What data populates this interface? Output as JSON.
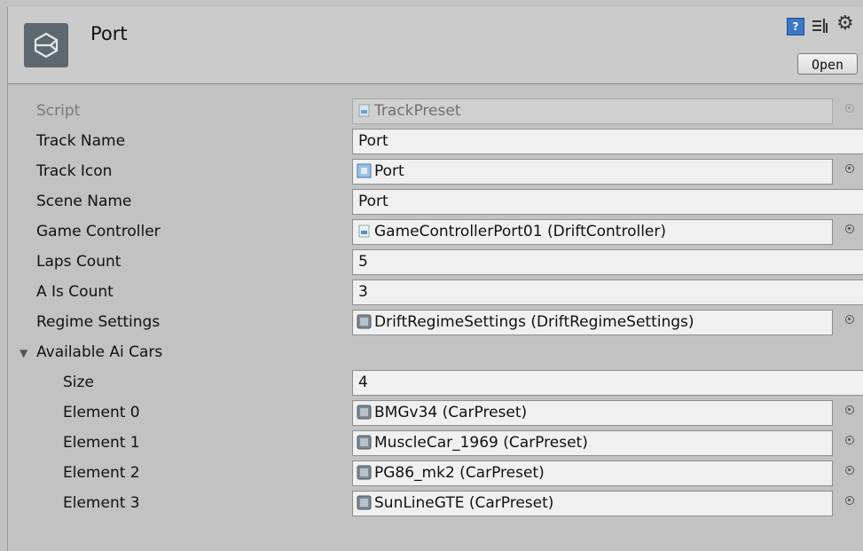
{
  "header": {
    "title": "Port",
    "open_label": "Open",
    "help_icon_text": "?"
  },
  "fields": [
    {
      "label": "Script",
      "value": "TrackPreset",
      "kind": "object",
      "icon": "script-icon",
      "disabled": true
    },
    {
      "label": "Track Name",
      "value": "Port",
      "kind": "text"
    },
    {
      "label": "Track Icon",
      "value": "Port",
      "kind": "object",
      "icon": "sprite-icon"
    },
    {
      "label": "Scene Name",
      "value": "Port",
      "kind": "text"
    },
    {
      "label": "Game Controller",
      "value": "GameControllerPort01 (DriftController)",
      "kind": "object",
      "icon": "script-icon"
    },
    {
      "label": "Laps Count",
      "value": "5",
      "kind": "text"
    },
    {
      "label": "A Is Count",
      "value": "3",
      "kind": "text"
    },
    {
      "label": "Regime Settings",
      "value": "DriftRegimeSettings (DriftRegimeSettings)",
      "kind": "object",
      "icon": "asset-icon"
    }
  ],
  "foldout": {
    "label": "Available Ai Cars",
    "expanded": true,
    "size_label": "Size",
    "size_value": "4",
    "elements": [
      {
        "label": "Element 0",
        "value": "BMGv34 (CarPreset)",
        "icon": "asset-icon"
      },
      {
        "label": "Element 1",
        "value": "MuscleCar_1969 (CarPreset)",
        "icon": "asset-icon"
      },
      {
        "label": "Element 2",
        "value": "PG86_mk2 (CarPreset)",
        "icon": "asset-icon"
      },
      {
        "label": "Element 3",
        "value": "SunLineGTE (CarPreset)",
        "icon": "asset-icon"
      }
    ]
  },
  "colors": {
    "background": "#c2c2c2",
    "field_bg": "#f0f0f0",
    "field_border": "#8e8e8e",
    "help_blue": "#3b78c5"
  }
}
